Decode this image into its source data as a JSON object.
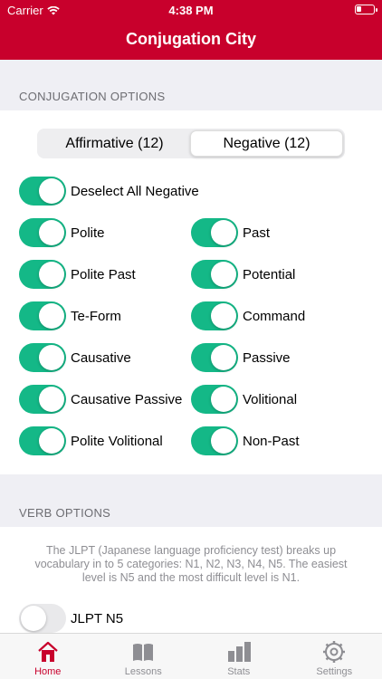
{
  "status_bar": {
    "carrier": "Carrier",
    "time": "4:38 PM"
  },
  "header": {
    "title": "Conjugation City"
  },
  "conjugation_section": {
    "title": "CONJUGATION OPTIONS",
    "segments": [
      {
        "label": "Affirmative (12)",
        "selected": false
      },
      {
        "label": "Negative (12)",
        "selected": true
      }
    ],
    "deselect_all": {
      "label": "Deselect All Negative",
      "on": true
    },
    "options": [
      {
        "label": "Polite",
        "on": true
      },
      {
        "label": "Past",
        "on": true
      },
      {
        "label": "Polite Past",
        "on": true
      },
      {
        "label": "Potential",
        "on": true
      },
      {
        "label": "Te-Form",
        "on": true
      },
      {
        "label": "Command",
        "on": true
      },
      {
        "label": "Causative",
        "on": true
      },
      {
        "label": "Passive",
        "on": true
      },
      {
        "label": "Causative Passive",
        "on": true
      },
      {
        "label": "Volitional",
        "on": true
      },
      {
        "label": "Polite Volitional",
        "on": true
      },
      {
        "label": "Non-Past",
        "on": true
      }
    ]
  },
  "verb_section": {
    "title": "VERB OPTIONS",
    "description": "The JLPT (Japanese language proficiency test) breaks up vocabulary in to 5 categories: N1, N2, N3, N4, N5. The easiest level is N5 and the most difficult level is N1.",
    "jlpt_n5": {
      "label": "JLPT N5",
      "on": false
    }
  },
  "tabbar": {
    "tabs": [
      {
        "label": "Home",
        "icon": "house-icon",
        "active": true
      },
      {
        "label": "Lessons",
        "icon": "book-icon",
        "active": false
      },
      {
        "label": "Stats",
        "icon": "bar-chart-icon",
        "active": false
      },
      {
        "label": "Settings",
        "icon": "gear-icon",
        "active": false
      }
    ]
  },
  "colors": {
    "brand_red": "#c8002c",
    "toggle_green": "#14b887"
  }
}
